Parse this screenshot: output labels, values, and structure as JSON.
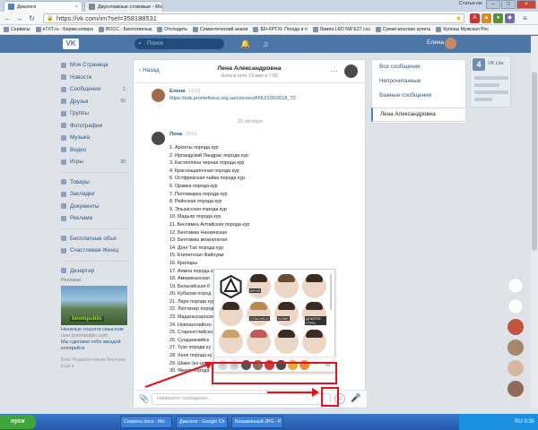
{
  "browser": {
    "tabs": [
      "Диалоги",
      "Двухэтажные стоковые - Мо"
    ],
    "url": "https://vk.com/im?sel=358188531",
    "user": "Статьи ме",
    "bookmarks": [
      "Сервисы",
      "eTXT.ru - Биржа копира",
      "BOCC - Биологиялық",
      "Отследить",
      "Семантический анали",
      "$3+XPTXt: Погода в п",
      "Лампа LED 5W E27 cxx",
      "Сумки женские купить",
      "Купоны Мужская Рос"
    ]
  },
  "vk_header": {
    "logo": "VK",
    "search_placeholder": "Поиск",
    "user_name": "Елена"
  },
  "left_nav": {
    "items": [
      {
        "label": "Моя Страница",
        "count": ""
      },
      {
        "label": "Новости",
        "count": ""
      },
      {
        "label": "Сообщения",
        "count": "1"
      },
      {
        "label": "Друзья",
        "count": "50"
      },
      {
        "label": "Группы",
        "count": ""
      },
      {
        "label": "Фотографии",
        "count": ""
      },
      {
        "label": "Музыка",
        "count": ""
      },
      {
        "label": "Видео",
        "count": ""
      },
      {
        "label": "Игры",
        "count": "36"
      }
    ],
    "items2": [
      "Товары",
      "Закладки",
      "Документы",
      "Реклама"
    ],
    "items3": [
      "Бесплатные объя",
      "Счастливая Женщ"
    ],
    "items4": [
      "Дезертир"
    ],
    "ad_title": "Реклама",
    "ad_brand": "boompublic",
    "ad_text": "Нехилые соцсети смыслом",
    "ad_sub": "user.boompublic.com",
    "ad_text2": "Мы сделаем тебя звездой копирайта",
    "footer": "Блог   Разработчикам   Реклама   Ещё ▾"
  },
  "chat": {
    "back_label": "Назад",
    "name": "Лена Александровна",
    "status": "была в сети 13 мин в 7:00",
    "msg1_author": "Елена",
    "msg1_time": "13:13",
    "msg1_text": "https://eds.prometheus.org.ua/courses/KNU/100/2018_T2",
    "date_sep": "25 октября",
    "msg2_author": "Лена",
    "msg2_time": "20:51",
    "list": [
      "1. Арсюты порода кур",
      "2. Ирландский Ландрас порода кур",
      "3. Кастелляна черная порода кур",
      "4. Краснощапочная порода кур",
      "5. Остфризская чайка порода кур",
      "6. Оравка порода кур",
      "7. Полтаварка порода кур",
      "8. Рейнская порода кур",
      "9. Эльзасская порода кур",
      "10. Мадьяр порода кур",
      "11. Бентамка Алтайская порода кур",
      "12. Бентамка Нанкинская",
      "13. Бентамка можноногая",
      "14. Донг Тао порода кур",
      "15. Египетская Файоуми",
      "16. Крилары",
      "17. Аямпа порода кур",
      "18. Американская",
      "19. Бельгийская б",
      "20. Кубалая пород",
      "21. Лари порода кур",
      "22. Люттихер пород",
      "23. Мадагаскарская",
      "24. Новоанглийско",
      "25. Старонгглийско",
      "26. Сунданезийск",
      "27. Тузо порода ку",
      "28. Хенп порода ку",
      "29. Шамо (ко-шам",
      "30. Ямато порода"
    ],
    "compose_placeholder": "Напишите сообщение..."
  },
  "stickers": {
    "captions": [
      "ВРОЙ",
      "СПАСИБО!",
      "БОЖЕ",
      "ДОБРОЕ УТРО",
      "",
      "",
      "",
      ""
    ]
  },
  "filters": {
    "items": [
      "Все сообщения",
      "Непрочитанные",
      "Важные сообщения"
    ],
    "selected": "Лена Александровна"
  },
  "widget": {
    "name": "VK Lite"
  },
  "taskbar": {
    "start": "пуск",
    "tasks": [
      "Секреты dvcs - Mo",
      "Диалоги - Google Ch",
      "Безымянный JPG - P"
    ],
    "tray": "RU  0:35"
  },
  "colors": {
    "vk_blue": "#4a76a8",
    "annotation_red": "#e0141e"
  }
}
